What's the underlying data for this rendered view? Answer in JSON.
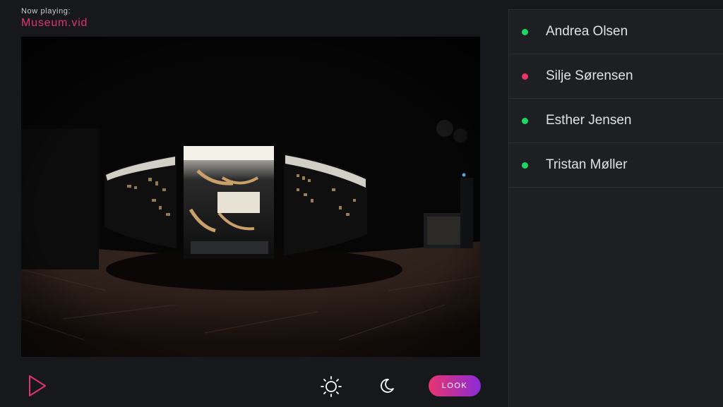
{
  "now_playing": {
    "label": "Now playing:",
    "file": "Museum.vid"
  },
  "video": {
    "scene": "360 museum exhibition hall with lit display cases"
  },
  "controls": {
    "play_icon": "play-icon",
    "brightness_icon": "sun-icon",
    "dark_mode_icon": "moon-icon",
    "look_label": "LOOK"
  },
  "users": [
    {
      "name": "Andrea Olsen",
      "status": "online",
      "color": "#1ed760"
    },
    {
      "name": "Silje Sørensen",
      "status": "busy",
      "color": "#e8356e"
    },
    {
      "name": "Esther Jensen",
      "status": "online",
      "color": "#1ed760"
    },
    {
      "name": "Tristan Møller",
      "status": "online",
      "color": "#1ed760"
    }
  ],
  "colors": {
    "accent": "#e0346c",
    "gradient_start": "#e8356e",
    "gradient_end": "#8a2bd8",
    "online": "#1ed760"
  }
}
